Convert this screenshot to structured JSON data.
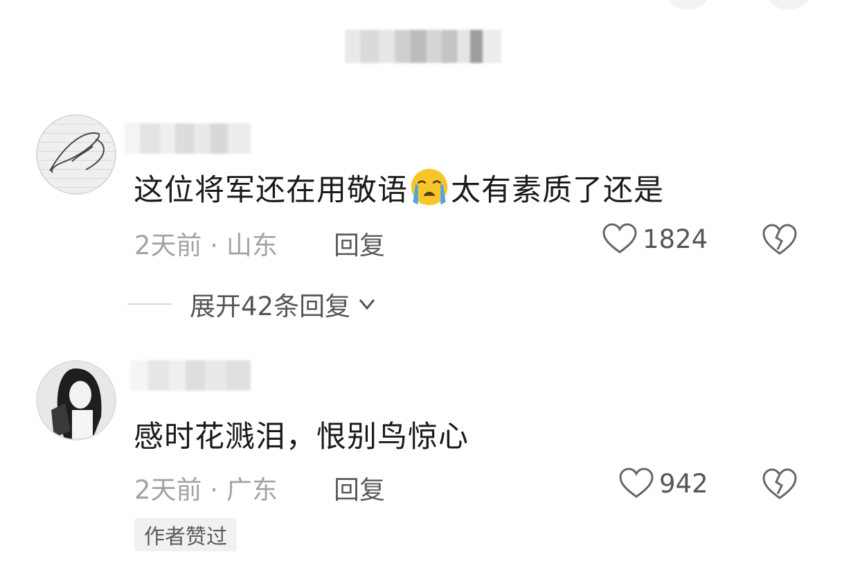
{
  "comments": [
    {
      "text_before": "这位将军还在用敬语",
      "emoji": "loudly-crying-face-emoji",
      "text_after": "太有素质了还是",
      "time_location": "2天前 · 山东",
      "reply_label": "回复",
      "likes": "1824"
    },
    {
      "text": "感时花溅泪，恨别鸟惊心",
      "time_location": "2天前 · 广东",
      "reply_label": "回复",
      "likes": "942",
      "badge": "作者赞过"
    }
  ],
  "expand_replies": {
    "label": "展开42条回复"
  },
  "colors": {
    "text_primary": "#1a1a1a",
    "text_meta": "#a3a3a3",
    "text_secondary": "#555555",
    "emoji_yellow": "#f7c52a",
    "emoji_tear": "#4da3e8"
  }
}
